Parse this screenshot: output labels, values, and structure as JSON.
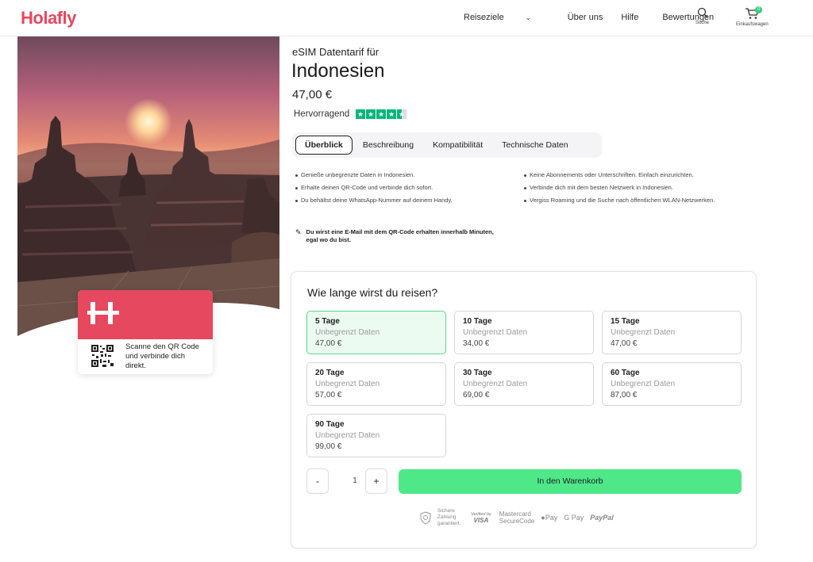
{
  "header": {
    "logo": "Holafly",
    "nav": [
      "Reiseziele",
      "Über uns",
      "Hilfe",
      "Bewertungen"
    ],
    "search_label": "Suche",
    "cart_label": "Einkaufswagen",
    "cart_count": "0"
  },
  "hero": {
    "card_logo": "H",
    "card_text": "Scanne den QR Code und verbinde dich direkt."
  },
  "product": {
    "subtitle": "eSIM Datentarif für",
    "title": "Indonesien",
    "price": "47,00 €",
    "rating_label": "Hervorragend",
    "rating_stars": 4.5
  },
  "tabs": [
    "Überblick",
    "Beschreibung",
    "Kompatibilität",
    "Technische Daten"
  ],
  "features_left": [
    "Genieße unbegrenzte Daten in Indonesien.",
    "Erhalte deinen QR-Code und verbinde dich sofort.",
    "Du behältst deine WhatsApp-Nummer auf deinem Handy."
  ],
  "features_right": [
    "Keine Abonnements oder Unterschriften. Einfach einzurichten.",
    "Verbinde dich mit dem besten Netzwerk in Indonesien.",
    "Vergiss Roaming und die Suche nach öffentlichen WLAN-Netzwerken."
  ],
  "notice": "Du wirst eine E-Mail mit dem QR-Code erhalten innerhalb Minuten, egal wo du bist.",
  "plans": {
    "title": "Wie lange wirst du reisen?",
    "options": [
      {
        "days": "5 Tage",
        "data": "Unbegrenzt Daten",
        "price": "47,00 €"
      },
      {
        "days": "10 Tage",
        "data": "Unbegrenzt Daten",
        "price": "34,00 €"
      },
      {
        "days": "15 Tage",
        "data": "Unbegrenzt Daten",
        "price": "47,00 €"
      },
      {
        "days": "20 Tage",
        "data": "Unbegrenzt Daten",
        "price": "57,00 €"
      },
      {
        "days": "30 Tage",
        "data": "Unbegrenzt Daten",
        "price": "69,00 €"
      },
      {
        "days": "60 Tage",
        "data": "Unbegrenzt Daten",
        "price": "87,00 €"
      },
      {
        "days": "90 Tage",
        "data": "Unbegrenzt Daten",
        "price": "99,00 €"
      }
    ],
    "selected": "5 Tage",
    "quantity": "1",
    "minus": "-",
    "plus": "+",
    "add_to_cart": "In den Warenkorb"
  },
  "payments": {
    "secure": "Sichere Zahlung garantiert.",
    "verified": "Verified by",
    "visa": "VISA",
    "mastercard": "Mastercard",
    "securecode": "SecureCode",
    "apple_pay": "Pay",
    "google_pay": "G Pay",
    "paypal": "PayPal"
  },
  "colors": {
    "brand": "#e6485f",
    "accent": "#4ee889",
    "trustpilot": "#00b67a"
  }
}
